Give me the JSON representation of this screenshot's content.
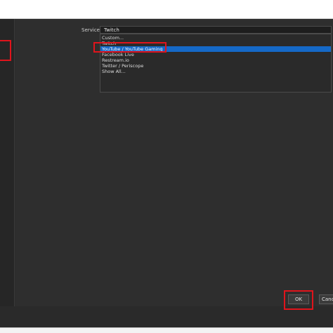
{
  "settings": {
    "service_label": "Service",
    "service_selected_value": "Twitch",
    "service_options": [
      "Custom...",
      "Twitch",
      "YouTube / YouTube Gaming",
      "Facebook Live",
      "Restream.io",
      "Twitter / Periscope",
      "Show All..."
    ],
    "highlighted_option": "YouTube / YouTube Gaming"
  },
  "footer": {
    "ok_label": "OK",
    "cancel_label": "Cancel"
  },
  "colors": {
    "callout_red": "#e0141c",
    "selection_blue": "#1569c7",
    "dialog_bg": "#2e2e2e"
  }
}
